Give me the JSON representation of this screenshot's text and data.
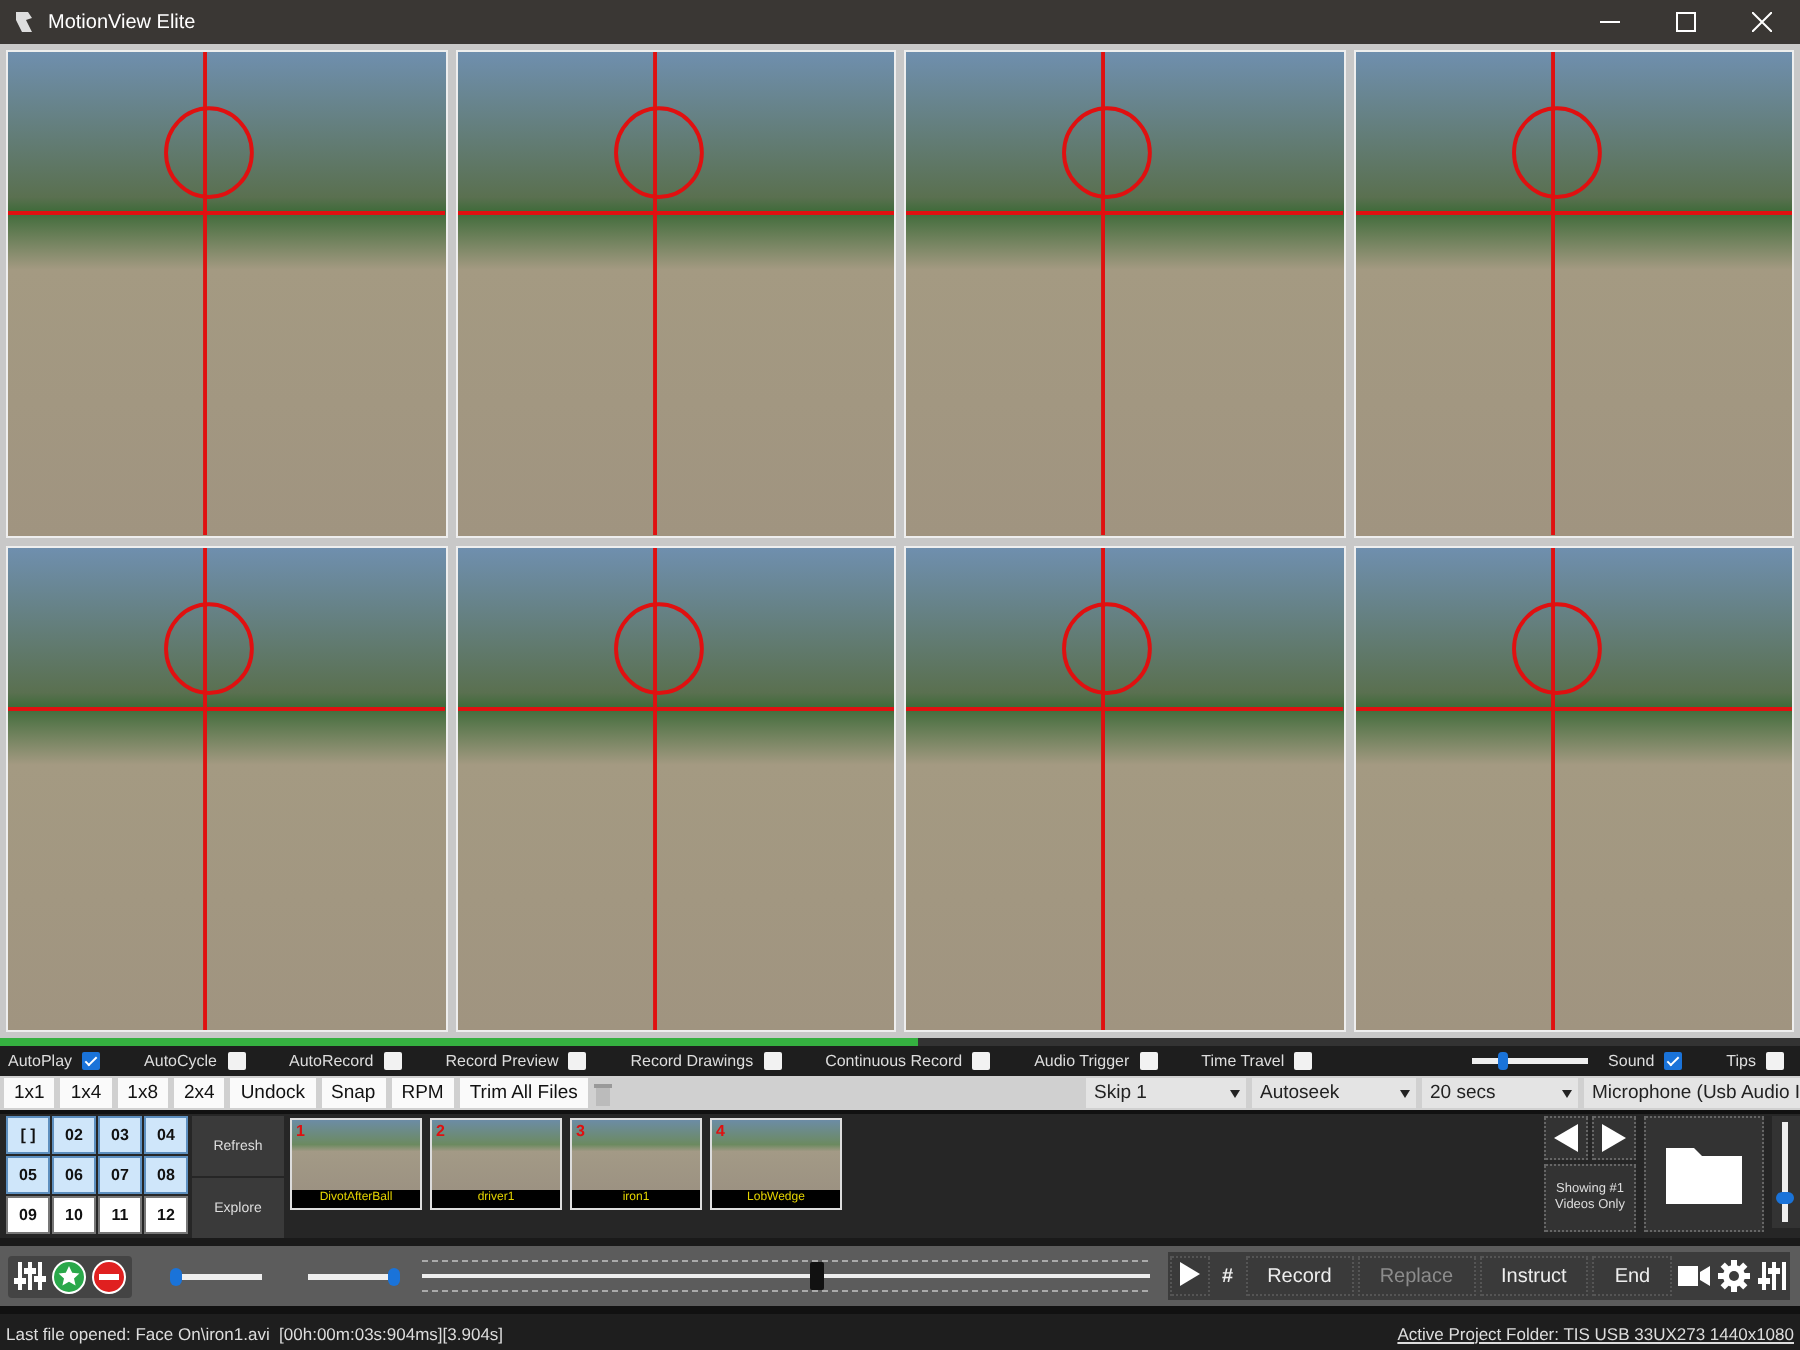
{
  "window": {
    "title": "MotionView Elite"
  },
  "video_frames": [
    {
      "selected": false
    },
    {
      "selected": false
    },
    {
      "selected": false
    },
    {
      "selected": false
    },
    {
      "selected": false
    },
    {
      "selected": false
    },
    {
      "selected": false
    },
    {
      "selected": false
    }
  ],
  "playback_progress": {
    "level": 0.51
  },
  "options": [
    {
      "label": "AutoPlay",
      "checked": true
    },
    {
      "label": "AutoCycle",
      "checked": false
    },
    {
      "label": "AutoRecord",
      "checked": false
    },
    {
      "label": "Record Preview",
      "checked": false
    },
    {
      "label": "Record Drawings",
      "checked": false
    },
    {
      "label": "Continuous Record",
      "checked": false
    },
    {
      "label": "Audio Trigger",
      "checked": false
    },
    {
      "label": "Time Travel",
      "checked": false
    }
  ],
  "sound": {
    "volume": {
      "level": 0.25
    },
    "label": "Sound",
    "checked": true
  },
  "tips": {
    "label": "Tips",
    "checked": false
  },
  "toolbar": {
    "buttons": [
      "1x1",
      "1x4",
      "1x8",
      "2x4",
      "Undock",
      "Snap",
      "RPM",
      "Trim All Files"
    ],
    "dropdowns": [
      {
        "value": "Skip 1"
      },
      {
        "value": "Autoseek"
      },
      {
        "value": "20 secs"
      },
      {
        "value": "Microphone (Usb Audio I"
      }
    ]
  },
  "slots": [
    {
      "label": "[ ]",
      "selected": true
    },
    {
      "label": "02",
      "selected": true
    },
    {
      "label": "03",
      "selected": true
    },
    {
      "label": "04",
      "selected": true
    },
    {
      "label": "05",
      "selected": true
    },
    {
      "label": "06",
      "selected": true
    },
    {
      "label": "07",
      "selected": true
    },
    {
      "label": "08",
      "selected": true
    },
    {
      "label": "09",
      "selected": false
    },
    {
      "label": "10",
      "selected": false
    },
    {
      "label": "11",
      "selected": false
    },
    {
      "label": "12",
      "selected": false
    }
  ],
  "library_buttons": [
    "Refresh",
    "Explore"
  ],
  "thumbnails": [
    {
      "number": "1",
      "label": "DivotAfterBall"
    },
    {
      "number": "2",
      "label": "driver1"
    },
    {
      "number": "3",
      "label": "iron1"
    },
    {
      "number": "4",
      "label": "LobWedge"
    }
  ],
  "showing": "Showing #1\nVideos Only",
  "zoom_slider": {
    "level": 0.25
  },
  "controls": {
    "slider_1": {
      "level": 0.03
    },
    "slider_2": {
      "level": 0.97
    },
    "timeline": {
      "level": 0.54
    },
    "hash": "#",
    "buttons": [
      {
        "label": "Record",
        "disabled": false
      },
      {
        "label": "Replace",
        "disabled": true
      },
      {
        "label": "Instruct",
        "disabled": false
      },
      {
        "label": "End",
        "disabled": false
      }
    ]
  },
  "status_bar": {
    "message": "Last file opened: Face On\\iron1.avi  [00h:00m:03s:904ms][3.904s]",
    "project_folder": "Active Project Folder: TIS USB 33UX273 1440x1080"
  }
}
